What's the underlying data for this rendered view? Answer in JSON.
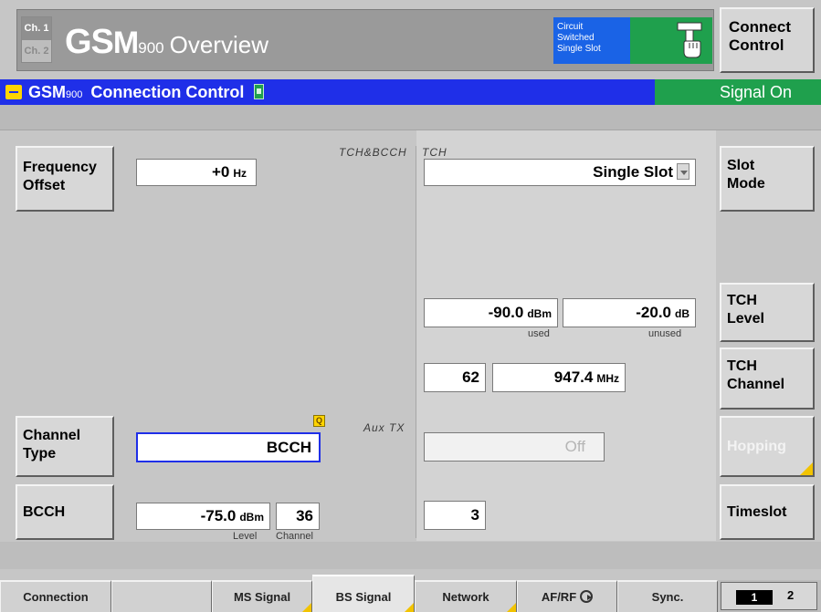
{
  "titlebar": {
    "ch1": "Ch. 1",
    "ch2": "Ch. 2",
    "title_big": "GS",
    "title_m": "M",
    "title_num": "900",
    "title_rest": "Overview",
    "mode_line1": "Circuit",
    "mode_line2": "Switched",
    "mode_line3": "Single Slot",
    "connect_label_1": "Connect",
    "connect_label_2": "Control"
  },
  "header": {
    "gsm_text": "GSM",
    "gsm_num": "900",
    "title": "Connection Control",
    "status": "Signal On"
  },
  "left": {
    "tch_bcch_label": "TCH&BCCH",
    "freq_offset_btn_1": "Frequency",
    "freq_offset_btn_2": "Offset",
    "freq_offset_value": "+0",
    "freq_offset_unit": "Hz",
    "aux_tx_label": "Aux TX",
    "channel_type_btn_1": "Channel",
    "channel_type_btn_2": "Type",
    "channel_type_value": "BCCH",
    "bcch_btn": "BCCH",
    "bcch_level_value": "-75.0",
    "bcch_level_unit": "dBm",
    "bcch_channel_value": "36",
    "level_caption": "Level",
    "channel_caption": "Channel"
  },
  "right": {
    "tch_label": "TCH",
    "slot_mode_value": "Single Slot",
    "slot_mode_btn_1": "Slot",
    "slot_mode_btn_2": "Mode",
    "tch_level_used_value": "-90.0",
    "tch_level_used_unit": "dBm",
    "tch_level_unused_value": "-20.0",
    "tch_level_unused_unit": "dB",
    "used_caption": "used",
    "unused_caption": "unused",
    "tch_level_btn_1": "TCH",
    "tch_level_btn_2": "Level",
    "tch_channel_value": "62",
    "tch_freq_value": "947.4",
    "tch_freq_unit": "MHz",
    "tch_channel_btn_1": "TCH",
    "tch_channel_btn_2": "Channel",
    "hopping_value": "Off",
    "hopping_btn": "Hopping",
    "timeslot_value": "3",
    "timeslot_btn": "Timeslot"
  },
  "tabs": [
    {
      "label": "Connection"
    },
    {
      "label": ""
    },
    {
      "label": "MS Signal"
    },
    {
      "label": "BS Signal"
    },
    {
      "label": "Network"
    },
    {
      "label": "AF/RF"
    },
    {
      "label": "Sync."
    }
  ],
  "channel_selector": {
    "one": "1",
    "two": "2"
  },
  "colors": {
    "header_blue": "#1f2fe8",
    "status_green": "#1fa04d",
    "mode_blue": "#1a63e6",
    "corner_yellow": "#f2c300"
  }
}
